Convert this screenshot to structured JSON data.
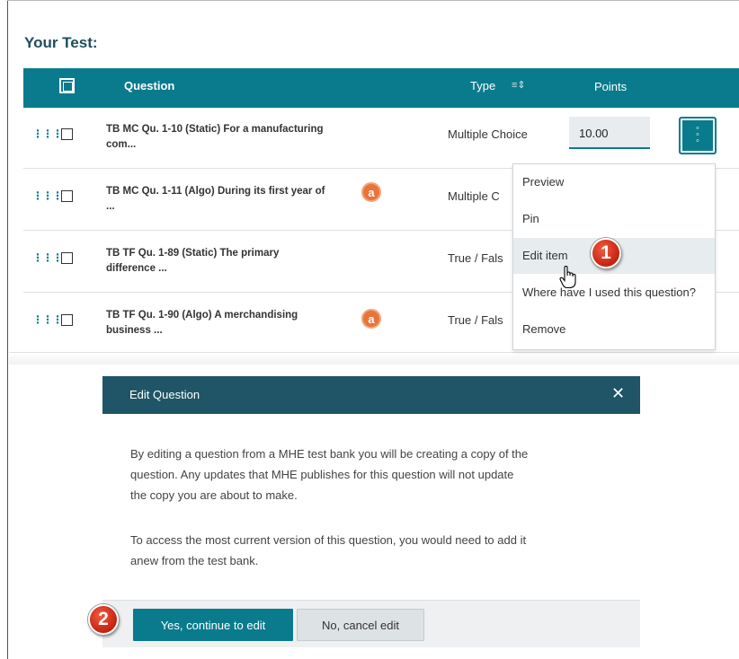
{
  "page": {
    "title": "Your Test:"
  },
  "table": {
    "headers": {
      "question": "Question",
      "type": "Type",
      "points": "Points"
    },
    "rows": [
      {
        "title_line1": "TB MC Qu. 1-10 (Static) For a manufacturing",
        "title_line2": "com...",
        "type": "Multiple Choice",
        "points": "10.00",
        "algo": false
      },
      {
        "title_line1": "TB MC Qu. 1-11 (Algo) During its first year of",
        "title_line2": "...",
        "type": "Multiple C",
        "algo": true,
        "algo_label": "a"
      },
      {
        "title_line1": "TB TF Qu. 1-89 (Static) The primary",
        "title_line2": "difference ...",
        "type": "True / Fals",
        "algo": false
      },
      {
        "title_line1": "TB TF Qu. 1-90 (Algo) A merchandising",
        "title_line2": "business ...",
        "type": "True / Fals",
        "algo": true,
        "algo_label": "a"
      }
    ]
  },
  "menu": {
    "items": [
      "Preview",
      "Pin",
      "Edit item",
      "Where have I used this question?",
      "Remove"
    ],
    "hovered": "Edit item"
  },
  "callouts": {
    "step1": "1",
    "step2": "2"
  },
  "dialog": {
    "title": "Edit Question",
    "close_glyph": "✕",
    "paragraph1_line1": "By editing a question from a MHE test bank you will be creating a copy of the",
    "paragraph1_line2": "question. Any updates that MHE publishes for this question will not update",
    "paragraph1_line3": "the copy you are about to make.",
    "paragraph2_line1": "To access the most current version of this question, you would need to add it",
    "paragraph2_line2": "anew from the test bank.",
    "confirm_label": "Yes, continue to edit",
    "cancel_label": "No, cancel edit"
  },
  "icons": {
    "drag": "drag-handle-icon",
    "sort": "sort-icon",
    "kebab": "more-options-icon",
    "close": "close-icon",
    "algo": "algorithmic-badge-icon",
    "cursor": "hand-pointer-icon"
  },
  "colors": {
    "header_teal": "#0a7b8d",
    "dialog_header": "#1f5566",
    "callout_red": "#d8311c",
    "algo_orange": "#e8743b"
  }
}
